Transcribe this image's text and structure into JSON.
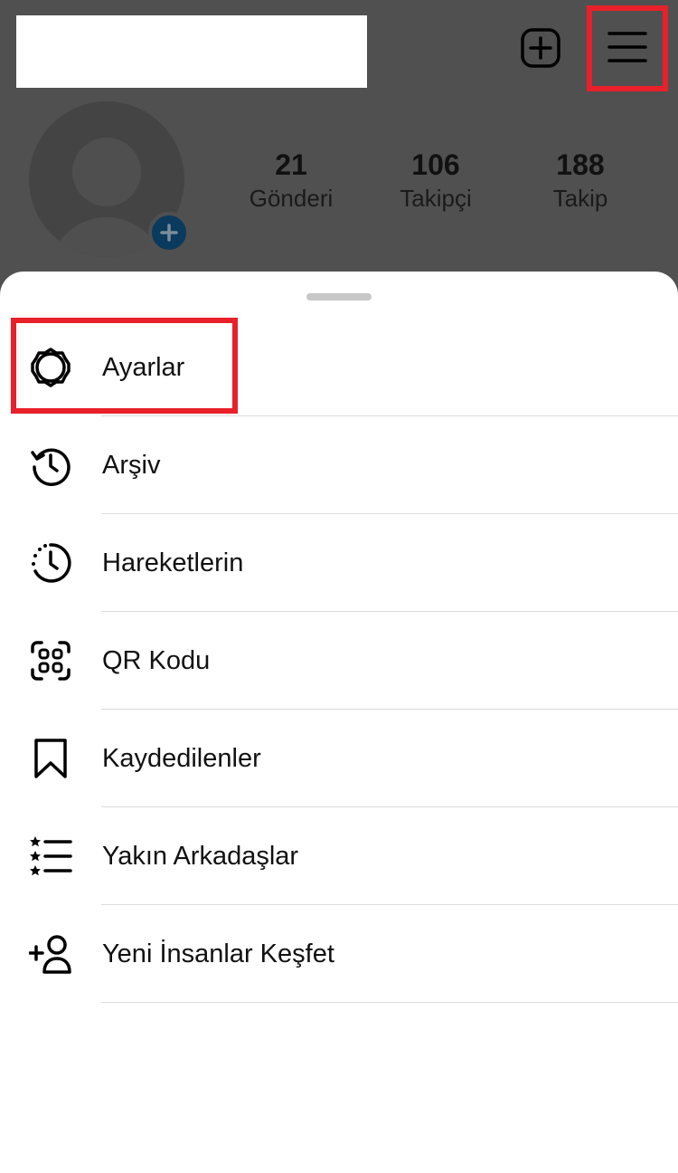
{
  "header": {
    "username": "",
    "new_post_icon": "plus-square-icon",
    "menu_icon": "hamburger-icon"
  },
  "profile": {
    "avatar_icon": "default-avatar",
    "add_story_icon": "plus-icon",
    "stats": [
      {
        "value": "21",
        "label": "Gönderi"
      },
      {
        "value": "106",
        "label": "Takipçi"
      },
      {
        "value": "188",
        "label": "Takip"
      }
    ]
  },
  "menu": {
    "items": [
      {
        "label": "Ayarlar",
        "icon": "gear-icon"
      },
      {
        "label": "Arşiv",
        "icon": "archive-history-icon"
      },
      {
        "label": "Hareketlerin",
        "icon": "activity-clock-icon"
      },
      {
        "label": "QR Kodu",
        "icon": "qr-code-icon"
      },
      {
        "label": "Kaydedilenler",
        "icon": "bookmark-icon"
      },
      {
        "label": "Yakın Arkadaşlar",
        "icon": "close-friends-list-icon"
      },
      {
        "label": "Yeni İnsanlar Keşfet",
        "icon": "add-person-icon"
      }
    ]
  },
  "colors": {
    "overlay": "#505050",
    "highlight_frame": "#e8202a",
    "add_story_badge": "#0a3a5e"
  }
}
